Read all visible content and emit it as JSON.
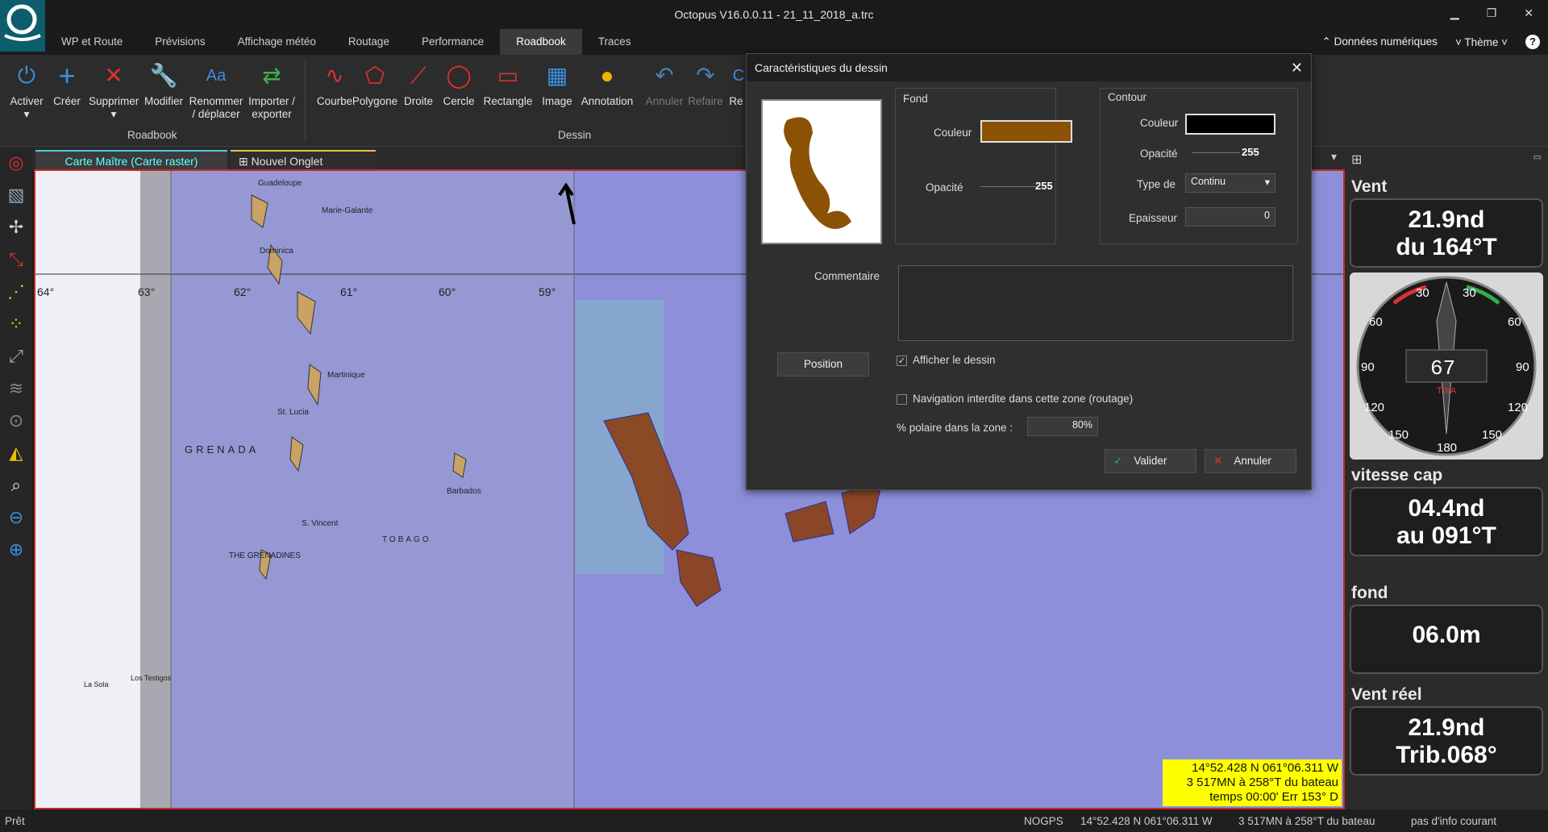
{
  "window": {
    "title": "Octopus V16.0.0.11 - 21_11_2018_a.trc"
  },
  "menu": {
    "tabs": [
      "WP et Route",
      "Prévisions",
      "Affichage météo",
      "Routage",
      "Performance",
      "Roadbook",
      "Traces"
    ],
    "right": {
      "numeric": "Données numériques",
      "theme": "Thème",
      "help": "?"
    }
  },
  "ribbon": {
    "roadbook": {
      "activer": "Activer",
      "creer": "Créer",
      "supprimer": "Supprimer",
      "modifier": "Modifier",
      "renommer": "Renommer / déplacer",
      "importer": "Importer / exporter",
      "group": "Roadbook"
    },
    "dessin": {
      "courbe": "Courbe",
      "polygone": "Polygone",
      "droite": "Droite",
      "cercle": "Cercle",
      "rectangle": "Rectangle",
      "image": "Image",
      "annotation": "Annotation",
      "annuler": "Annuler",
      "refaire": "Refaire",
      "re": "Re",
      "group": "Dessin"
    }
  },
  "doc_tabs": {
    "master": "Carte Maître (Carte raster)",
    "new": "Nouvel Onglet"
  },
  "map": {
    "lat_labels": [
      "64°",
      "63°",
      "62°",
      "61°",
      "60°",
      "59°"
    ],
    "places": [
      "Guadeloupe",
      "Marie-Galante",
      "Dominica",
      "Martinique",
      "St. Lucia",
      "S. Vincent",
      "Barbados",
      "GRENADA",
      "THE GRENADINES",
      "TOBAGO",
      "Los Testigos",
      "La Sola"
    ],
    "coords": {
      "line1": "14°52.428 N  061°06.311 W",
      "line2": "3 517MN à 258°T du bateau",
      "line3": "temps 00:00' Err 153° D"
    }
  },
  "right_panel": {
    "vent": {
      "title": "Vent",
      "line1": "21.9nd",
      "line2": "du 164°T"
    },
    "gauge": {
      "twa": "67",
      "label": "TWA",
      "ticks": [
        "30",
        "30",
        "60",
        "60",
        "90",
        "90",
        "120",
        "120",
        "150",
        "150",
        "180"
      ]
    },
    "vitesse": {
      "title": "vitesse cap",
      "line1": "04.4nd",
      "line2": "au 091°T"
    },
    "fond": {
      "title": "fond",
      "line1": "06.0m"
    },
    "vent_reel": {
      "title": "Vent réel",
      "line1": "21.9nd",
      "line2": "Trib.068°"
    }
  },
  "dialog": {
    "title": "Caractéristiques du dessin",
    "fond": {
      "legend": "Fond",
      "couleur_label": "Couleur",
      "couleur": "#8b5206",
      "opacite_label": "Opacité",
      "opacite": "255"
    },
    "contour": {
      "legend": "Contour",
      "couleur_label": "Couleur",
      "couleur": "#000000",
      "opacite_label": "Opacité",
      "opacite": "255",
      "type_label": "Type de",
      "type": "Continu",
      "epaisseur_label": "Epaisseur",
      "epaisseur": "0"
    },
    "commentaire_label": "Commentaire",
    "position_button": "Position",
    "afficher": "Afficher le dessin",
    "navigation": "Navigation interdite dans cette zone (routage)",
    "polaire_label": "% polaire dans la zone :",
    "polaire": "80%",
    "valider": "Valider",
    "annuler": "Annuler"
  },
  "status": {
    "left": "Prêt",
    "nogps": "NOGPS",
    "pos": "14°52.428 N  061°06.311 W",
    "dist": "3 517MN à 258°T du bateau",
    "info": "pas d'info courant"
  }
}
